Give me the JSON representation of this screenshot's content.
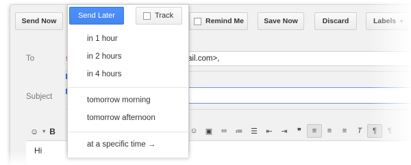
{
  "toolbar": {
    "send_now": "Send Now",
    "remind_me": "Remind Me",
    "save_now": "Save Now",
    "discard": "Discard",
    "labels": "Labels"
  },
  "schedule": {
    "send_later": "Send Later",
    "track": "Track",
    "items": [
      "in 1 hour",
      "in 2 hours",
      "in 4 hours",
      "tomorrow morning",
      "tomorrow afternoon",
      "at a specific time →"
    ]
  },
  "fields": {
    "to_label": "To",
    "to_value": "ail.com>,",
    "subject_label": "Subject"
  },
  "body": {
    "text": "Hi"
  },
  "colors": {
    "accent": "#4d90fe",
    "send_later_text": "#ffffff"
  }
}
